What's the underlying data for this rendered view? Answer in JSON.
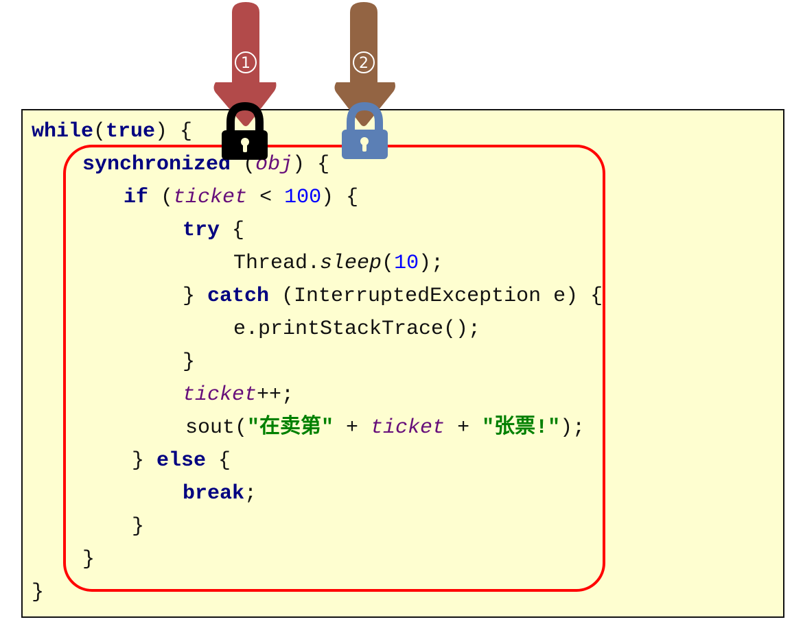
{
  "arrows": [
    {
      "label": "①",
      "color": "#b24a4a"
    },
    {
      "label": "②",
      "color": "#936443"
    }
  ],
  "locks": [
    {
      "name": "locked",
      "color": "#000000"
    },
    {
      "name": "unlocked-waiting",
      "color": "#5b7fb5"
    }
  ],
  "frame_color": "#ff0000",
  "code": [
    {
      "indent": 46,
      "tokens": [
        [
          "kw",
          "while"
        ],
        [
          "",
          "("
        ],
        [
          "kw",
          "true"
        ],
        [
          "",
          ") {"
        ]
      ]
    },
    {
      "indent": 120,
      "tokens": [
        [
          "kw",
          "synchronized"
        ],
        [
          "",
          " ("
        ],
        [
          "field",
          "obj"
        ],
        [
          "",
          ") {"
        ]
      ]
    },
    {
      "indent": 180,
      "tokens": [
        [
          "kw",
          "if"
        ],
        [
          "",
          " ("
        ],
        [
          "field",
          "ticket"
        ],
        [
          "",
          " < "
        ],
        [
          "num",
          "100"
        ],
        [
          "",
          ") {"
        ]
      ]
    },
    {
      "indent": 266,
      "tokens": [
        [
          "kw",
          "try"
        ],
        [
          "",
          " {"
        ]
      ]
    },
    {
      "indent": 340,
      "tokens": [
        [
          "",
          "Thread."
        ],
        [
          "static",
          "sleep"
        ],
        [
          "",
          "("
        ],
        [
          "num",
          "10"
        ],
        [
          "",
          ");"
        ]
      ]
    },
    {
      "indent": 266,
      "tokens": [
        [
          "",
          "} "
        ],
        [
          "kw",
          "catch"
        ],
        [
          "",
          " (InterruptedException e) {"
        ]
      ]
    },
    {
      "indent": 340,
      "tokens": [
        [
          "",
          "e.printStackTrace();"
        ]
      ]
    },
    {
      "indent": 266,
      "tokens": [
        [
          "",
          "}"
        ]
      ]
    },
    {
      "indent": 266,
      "tokens": [
        [
          "field",
          "ticket"
        ],
        [
          "",
          "++;"
        ]
      ]
    },
    {
      "indent": 270,
      "tokens": [
        [
          "",
          "sout("
        ],
        [
          "str",
          "\"在卖第\""
        ],
        [
          "",
          " + "
        ],
        [
          "field",
          "ticket"
        ],
        [
          "",
          " + "
        ],
        [
          "str",
          "\"张票!\""
        ],
        [
          "",
          ");"
        ]
      ]
    },
    {
      "indent": 192,
      "tokens": [
        [
          "",
          "} "
        ],
        [
          "kw",
          "else"
        ],
        [
          "",
          " {"
        ]
      ]
    },
    {
      "indent": 266,
      "tokens": [
        [
          "kw",
          "break"
        ],
        [
          "",
          ";"
        ]
      ]
    },
    {
      "indent": 192,
      "tokens": [
        [
          "",
          "}"
        ]
      ]
    },
    {
      "indent": 120,
      "tokens": [
        [
          "",
          "}"
        ]
      ]
    },
    {
      "indent": 46,
      "tokens": [
        [
          "",
          "}"
        ]
      ]
    }
  ]
}
